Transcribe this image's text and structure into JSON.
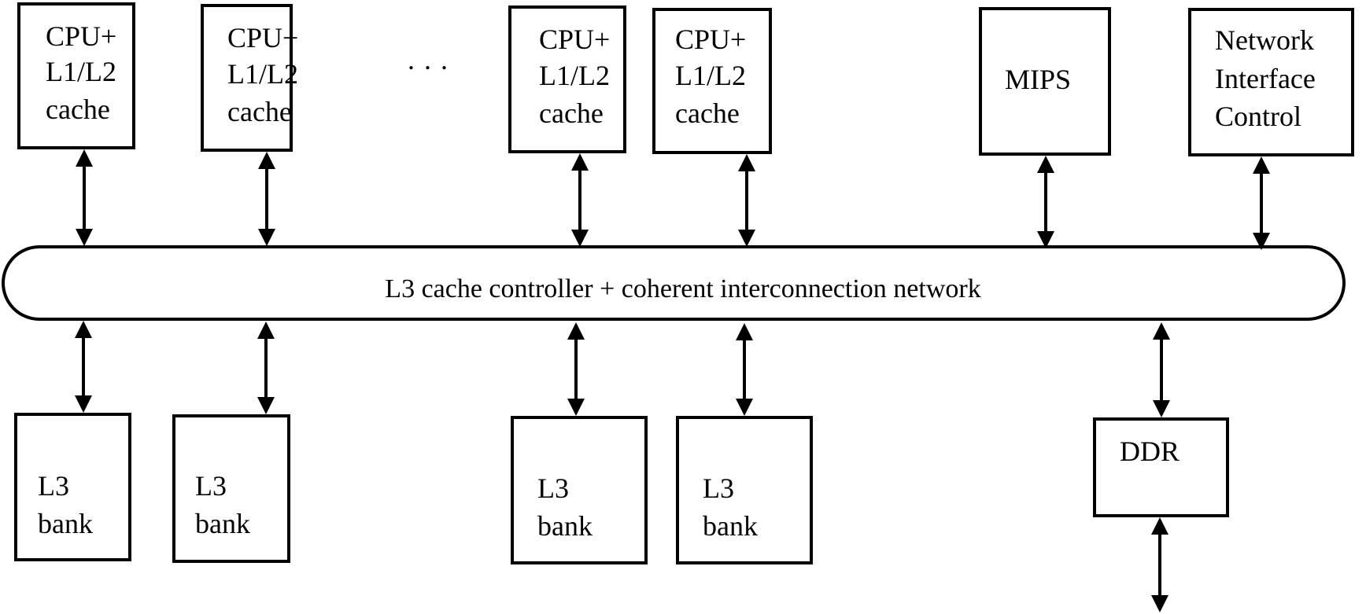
{
  "diagram": {
    "top_components": [
      {
        "id": "cpu1",
        "lines": [
          "CPU+",
          "L1/L2",
          "cache"
        ]
      },
      {
        "id": "cpu2",
        "lines": [
          "CPU+",
          "L1/L2",
          "cache"
        ]
      },
      {
        "id": "cpu3",
        "lines": [
          "CPU+",
          "L1/L2",
          "cache"
        ]
      },
      {
        "id": "cpu4",
        "lines": [
          "CPU+",
          "L1/L2",
          "cache"
        ]
      },
      {
        "id": "mips",
        "lines": [
          "MIPS"
        ]
      },
      {
        "id": "nic",
        "lines": [
          "Network",
          "Interface",
          "Control"
        ]
      }
    ],
    "ellipsis": "...",
    "bus": {
      "label": "L3 cache controller + coherent interconnection network"
    },
    "bottom_components": [
      {
        "id": "l3bank1",
        "lines": [
          "L3",
          "bank"
        ]
      },
      {
        "id": "l3bank2",
        "lines": [
          "L3",
          "bank"
        ]
      },
      {
        "id": "l3bank3",
        "lines": [
          "L3",
          "bank"
        ]
      },
      {
        "id": "l3bank4",
        "lines": [
          "L3",
          "bank"
        ]
      },
      {
        "id": "ddr",
        "lines": [
          "DDR"
        ]
      }
    ],
    "connections": [
      {
        "from": "cpu1",
        "to": "bus",
        "type": "bidirectional"
      },
      {
        "from": "cpu2",
        "to": "bus",
        "type": "bidirectional"
      },
      {
        "from": "cpu3",
        "to": "bus",
        "type": "bidirectional"
      },
      {
        "from": "cpu4",
        "to": "bus",
        "type": "bidirectional"
      },
      {
        "from": "mips",
        "to": "bus",
        "type": "bidirectional"
      },
      {
        "from": "nic",
        "to": "bus",
        "type": "bidirectional"
      },
      {
        "from": "bus",
        "to": "l3bank1",
        "type": "bidirectional"
      },
      {
        "from": "bus",
        "to": "l3bank2",
        "type": "bidirectional"
      },
      {
        "from": "bus",
        "to": "l3bank3",
        "type": "bidirectional"
      },
      {
        "from": "bus",
        "to": "l3bank4",
        "type": "bidirectional"
      },
      {
        "from": "bus",
        "to": "ddr",
        "type": "bidirectional"
      },
      {
        "from": "ddr",
        "to": "external",
        "type": "bidirectional"
      }
    ]
  }
}
